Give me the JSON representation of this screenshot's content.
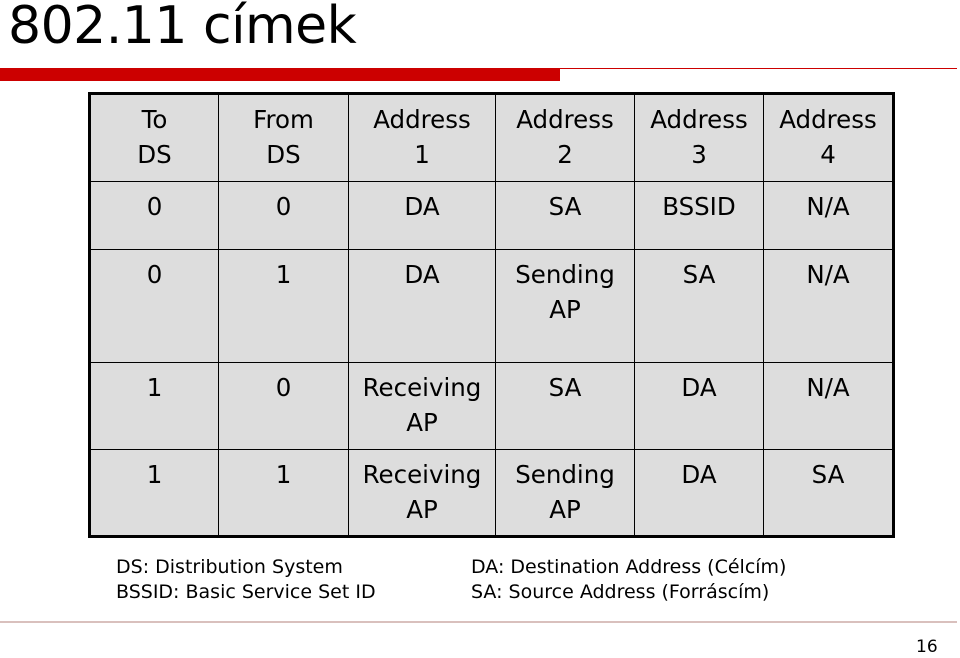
{
  "slide": {
    "title": "802.11 címek",
    "page_number": "16",
    "accent_color": "#cc0000"
  },
  "table": {
    "headers": [
      [
        "To",
        "DS"
      ],
      [
        "From",
        "DS"
      ],
      [
        "Address",
        "1"
      ],
      [
        "Address",
        "2"
      ],
      [
        "Address",
        "3"
      ],
      [
        "Address",
        "4"
      ]
    ],
    "rows": [
      [
        [
          "0"
        ],
        [
          "0"
        ],
        [
          "DA"
        ],
        [
          "SA"
        ],
        [
          "BSSID"
        ],
        [
          "N/A"
        ]
      ],
      [
        [
          "0"
        ],
        [
          "1"
        ],
        [
          "DA"
        ],
        [
          "Sending",
          "AP"
        ],
        [
          "SA"
        ],
        [
          "N/A"
        ]
      ],
      [
        [
          "1"
        ],
        [
          "0"
        ],
        [
          "Receiving",
          "AP"
        ],
        [
          "SA"
        ],
        [
          "DA"
        ],
        [
          "N/A"
        ]
      ],
      [
        [
          "1"
        ],
        [
          "1"
        ],
        [
          "Receiving",
          "AP"
        ],
        [
          "Sending",
          "AP"
        ],
        [
          "DA"
        ],
        [
          "SA"
        ]
      ]
    ]
  },
  "legend": {
    "left": [
      "DS: Distribution System",
      "BSSID: Basic Service Set ID"
    ],
    "right": [
      "DA: Destination Address (Célcím)",
      "SA: Source Address (Forráscím)"
    ]
  }
}
